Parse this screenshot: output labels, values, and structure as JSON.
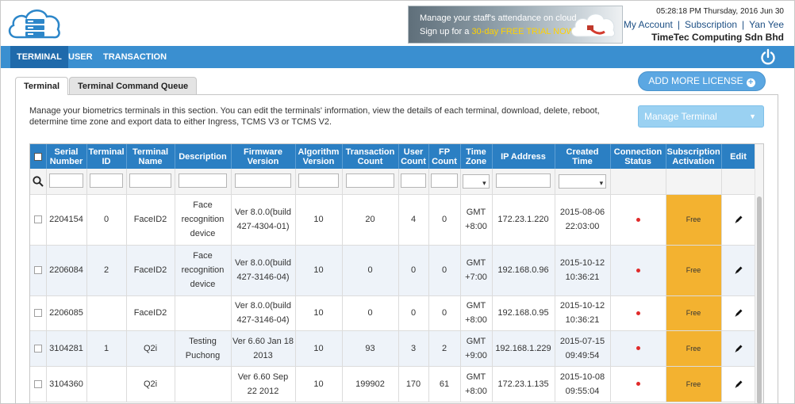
{
  "header": {
    "banner_line1": "Manage your staff's attendance on cloud",
    "banner_line2_prefix": "Sign up for a",
    "banner_line2_highlight": "30-day FREE TRIAL NOW!",
    "clock": "05:28:18 PM Thursday, 2016 Jun 30",
    "account_links": [
      "My Account",
      "Subscription",
      "Yan Yee"
    ],
    "company": "TimeTec Computing Sdn Bhd"
  },
  "nav": {
    "items": [
      "TERMINAL",
      "USER",
      "TRANSACTION"
    ],
    "active": "TERMINAL"
  },
  "tabs": [
    "Terminal",
    "Terminal Command Queue"
  ],
  "buttons": {
    "add_license": "ADD MORE LICENSE",
    "manage_terminal": "Manage Terminal"
  },
  "description": "Manage your biometrics terminals in this section. You can edit the terminals' information, view the details of each terminal, download, delete, reboot, determine time zone and export data to either Ingress, TCMS V3 or TCMS V2.",
  "table": {
    "headers": [
      "Serial Number",
      "Terminal ID",
      "Terminal Name",
      "Description",
      "Firmware Version",
      "Algorithm Version",
      "Transaction Count",
      "User Count",
      "FP Count",
      "Time Zone",
      "IP Address",
      "Created Time",
      "Connection Status",
      "Subscription Activation",
      "Edit"
    ],
    "rows": [
      {
        "serial": "2204154",
        "tid": "0",
        "name": "FaceID2",
        "desc": "Face recognition device",
        "firmware": "Ver 8.0.0(build 427-4304-01)",
        "algo": "10",
        "trans": "20",
        "users": "4",
        "fp": "0",
        "tz": "GMT +8:00",
        "ip": "172.23.1.220",
        "created": "2015-08-06 22:03:00",
        "sub": "Free"
      },
      {
        "serial": "2206084",
        "tid": "2",
        "name": "FaceID2",
        "desc": "Face recognition device",
        "firmware": "Ver 8.0.0(build 427-3146-04)",
        "algo": "10",
        "trans": "0",
        "users": "0",
        "fp": "0",
        "tz": "GMT +7:00",
        "ip": "192.168.0.96",
        "created": "2015-10-12 10:36:21",
        "sub": "Free"
      },
      {
        "serial": "2206085",
        "tid": "",
        "name": "FaceID2",
        "desc": "",
        "firmware": "Ver 8.0.0(build 427-3146-04)",
        "algo": "10",
        "trans": "0",
        "users": "0",
        "fp": "0",
        "tz": "GMT +8:00",
        "ip": "192.168.0.95",
        "created": "2015-10-12 10:36:21",
        "sub": "Free"
      },
      {
        "serial": "3104281",
        "tid": "1",
        "name": "Q2i",
        "desc": "Testing Puchong",
        "firmware": "Ver 6.60 Jan 18 2013",
        "algo": "10",
        "trans": "93",
        "users": "3",
        "fp": "2",
        "tz": "GMT +9:00",
        "ip": "192.168.1.229",
        "created": "2015-07-15 09:49:54",
        "sub": "Free"
      },
      {
        "serial": "3104360",
        "tid": "",
        "name": "Q2i",
        "desc": "",
        "firmware": "Ver 6.60 Sep 22 2012",
        "algo": "10",
        "trans": "199902",
        "users": "170",
        "fp": "61",
        "tz": "GMT +8:00",
        "ip": "172.23.1.135",
        "created": "2015-10-08 09:55:04",
        "sub": "Free"
      }
    ]
  },
  "colors": {
    "nav_bg": "#3a8fd0",
    "nav_active": "#1f6aab",
    "table_header": "#2b7fc3",
    "subscription_free": "#f3b230",
    "status_offline": "#e02a2a"
  }
}
